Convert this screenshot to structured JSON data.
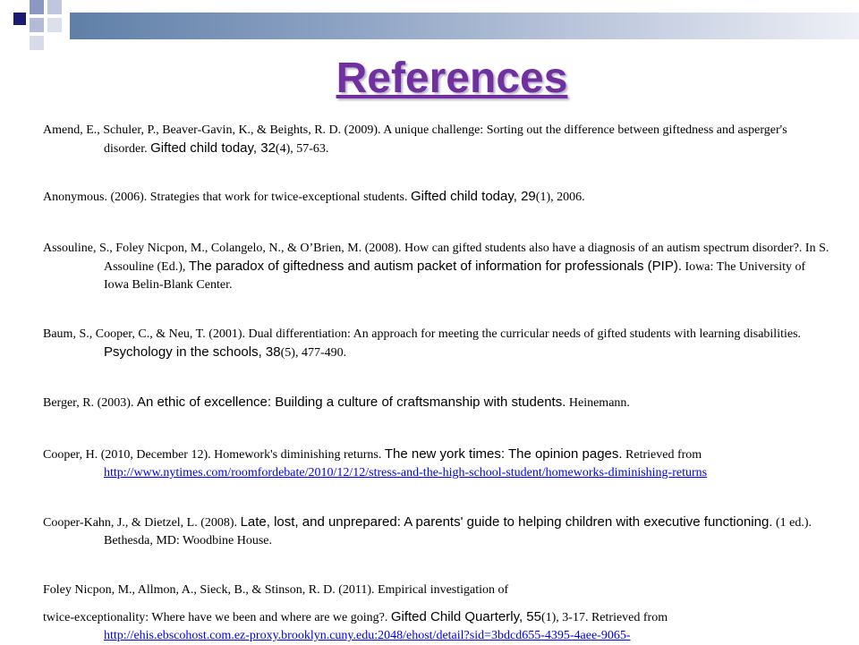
{
  "slide": {
    "title": "References"
  },
  "references": [
    {
      "pre": "Amend, E., Schuler, P., Beaver-Gavin, K., & Beights, R. D. (2009). A unique challenge: Sorting out the difference between giftedness and asperger's disorder. ",
      "italic": "Gifted child today, 32",
      "post": "(4), 57-63.",
      "link": ""
    },
    {
      "pre": "Anonymous. (2006). Strategies that work for twice-exceptional students. ",
      "italic": "Gifted child today, 29",
      "post": "(1), 2006.",
      "link": ""
    },
    {
      "pre": "Assouline, S., Foley Nicpon, M., Colangelo, N., & O’Brien, M. (2008). How can gifted students also have a diagnosis of an autism spectrum disorder?. In S. Assouline (Ed.), ",
      "italic": "The paradox of giftedness and autism packet of information for professionals (PIP).",
      "post": " Iowa: The University of Iowa Belin-Blank Center.",
      "link": ""
    },
    {
      "pre": "Baum, S., Cooper, C., & Neu, T. (2001). Dual differentiation: An approach for meeting the curricular needs of gifted students with learning disabilities. ",
      "italic": "Psychology in the schools, 38",
      "post": "(5), 477-490.",
      "link": ""
    },
    {
      "pre": "Berger, R. (2003). ",
      "italic": "An ethic of excellence: Building a culture of craftsmanship with students.",
      "post": " Heinemann.",
      "link": ""
    },
    {
      "pre": "Cooper, H. (2010, December 12). Homework's diminishing returns. ",
      "italic": "The new york times: The opinion pages.",
      "post": " Retrieved from ",
      "link": "http://www.nytimes.com/roomfordebate/2010/12/12/stress-and-the-high-school-student/homeworks-diminishing-returns"
    },
    {
      "pre": "Cooper-Kahn, J., & Dietzel, L. (2008). ",
      "italic": "Late, lost, and unprepared: A parents' guide to helping children with executive functioning.",
      "post": " (1 ed.). Bethesda, MD: Woodbine House.",
      "link": ""
    },
    {
      "pre": "Foley Nicpon, M., Allmon, A., Sieck, B., & Stinson, R. D. (2011). Empirical investigation of",
      "italic": "",
      "post": "",
      "link": ""
    },
    {
      "pre": "twice-exceptionality: Where have we been and where are we going?. ",
      "italic": "Gifted Child Quarterly, 55",
      "post": "(1), 3-17. Retrieved from ",
      "link": "http://ehis.ebscohost.com.ez-proxy.brooklyn.cuny.edu:2048/ehost/detail?sid=3bdcd655-4395-4aee-9065-"
    }
  ]
}
